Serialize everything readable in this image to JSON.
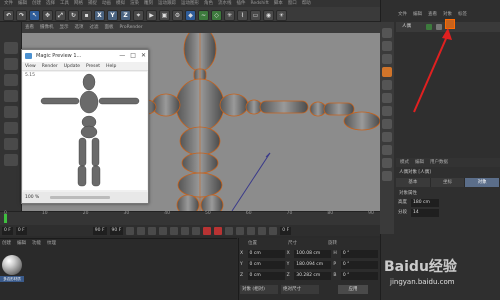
{
  "menubar": {
    "items": [
      "文件",
      "编辑",
      "创建",
      "选择",
      "工具",
      "网格",
      "捕捉",
      "动画",
      "模拟",
      "渲染",
      "雕刻",
      "运动跟踪",
      "运动图形",
      "角色",
      "流水线",
      "插件",
      "Redshift",
      "脚本",
      "窗口",
      "帮助"
    ]
  },
  "toolbar": {
    "axis_x": "X",
    "axis_y": "Y",
    "axis_z": "Z"
  },
  "viewport": {
    "menu": [
      "查看",
      "摄像机",
      "显示",
      "选项",
      "过滤",
      "面板",
      "ProRender"
    ]
  },
  "preview_window": {
    "title": "Magic Preview 1...",
    "minimize": "—",
    "maximize": "□",
    "close": "✕",
    "menu": [
      "View",
      "Render",
      "Update",
      "Preset",
      "Help"
    ],
    "render_time": "5.15",
    "zoom": "100 %"
  },
  "object_manager": {
    "menu": [
      "文件",
      "编辑",
      "查看",
      "对象",
      "标签"
    ],
    "object_name": "人偶"
  },
  "attribute_manager": {
    "tabs": [
      "模式",
      "编辑",
      "用户数据"
    ],
    "object_label": "人偶对象 [人偶]",
    "subtabs": [
      "基本",
      "坐标",
      "对象"
    ],
    "active_subtab_index": 2,
    "section_title": "对象属性",
    "height_label": "高度",
    "height_value": "180 cm",
    "segments_label": "分段",
    "segments_value": "14"
  },
  "timeline": {
    "ticks": [
      "0",
      "10",
      "20",
      "30",
      "40",
      "50",
      "60",
      "70",
      "80",
      "90"
    ],
    "current_frame": "0 F",
    "start_frame": "0 F",
    "end_frame": "90 F",
    "end_frame_2": "90 F",
    "current_frame_indicator": "0 F",
    "playhead_frame": 0
  },
  "material_manager": {
    "menu": [
      "创建",
      "编辑",
      "功能",
      "纹理"
    ],
    "material_name": "多边形材质"
  },
  "coordinate_manager": {
    "headers": [
      "位置",
      "尺寸",
      "旋转"
    ],
    "rows": [
      {
        "axis": "X",
        "pos": "0 cm",
        "axis2": "X",
        "size": "100.08 cm",
        "axis3": "H",
        "rot": "0 °"
      },
      {
        "axis": "Y",
        "pos": "0 cm",
        "axis2": "Y",
        "size": "180.094 cm",
        "axis3": "P",
        "rot": "0 °"
      },
      {
        "axis": "Z",
        "pos": "0 cm",
        "axis2": "Z",
        "size": "30.282 cm",
        "axis3": "B",
        "rot": "0 °"
      }
    ],
    "mode_select": "对象 (相对)",
    "size_select": "绝对尺寸",
    "apply_button": "应用"
  },
  "watermark": {
    "line1": "Baidu经验",
    "line2": "jingyan.baidu.com"
  },
  "colors": {
    "accent_orange": "#c8621b",
    "annotation_red": "#e02020",
    "playhead_green": "#3fbf3f",
    "viewport_bg": "#8c8c8c"
  }
}
